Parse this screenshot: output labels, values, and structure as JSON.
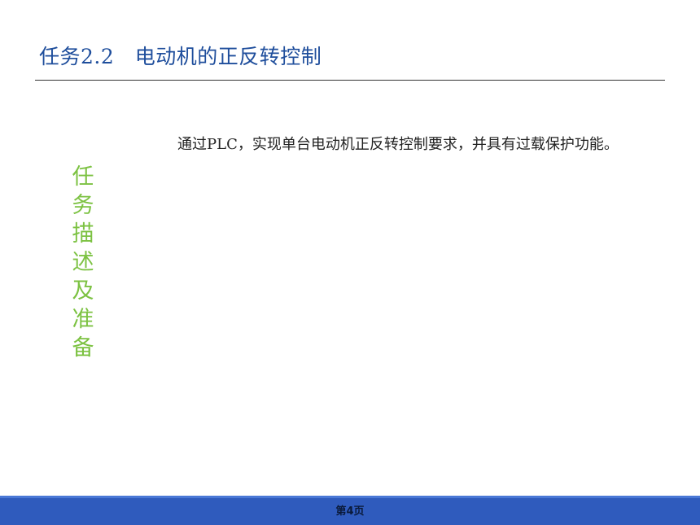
{
  "slide": {
    "title": "任务2.2　电动机的正反转控制",
    "body_text": "通过PLC，实现单台电动机正反转控制要求，并具有过载保护功能。",
    "side_label": "任务描述及准备",
    "page_number": "第4页"
  },
  "colors": {
    "title": "#1f4e9c",
    "side_label": "#7cc242",
    "footer_bar": "#2f5bbd"
  }
}
